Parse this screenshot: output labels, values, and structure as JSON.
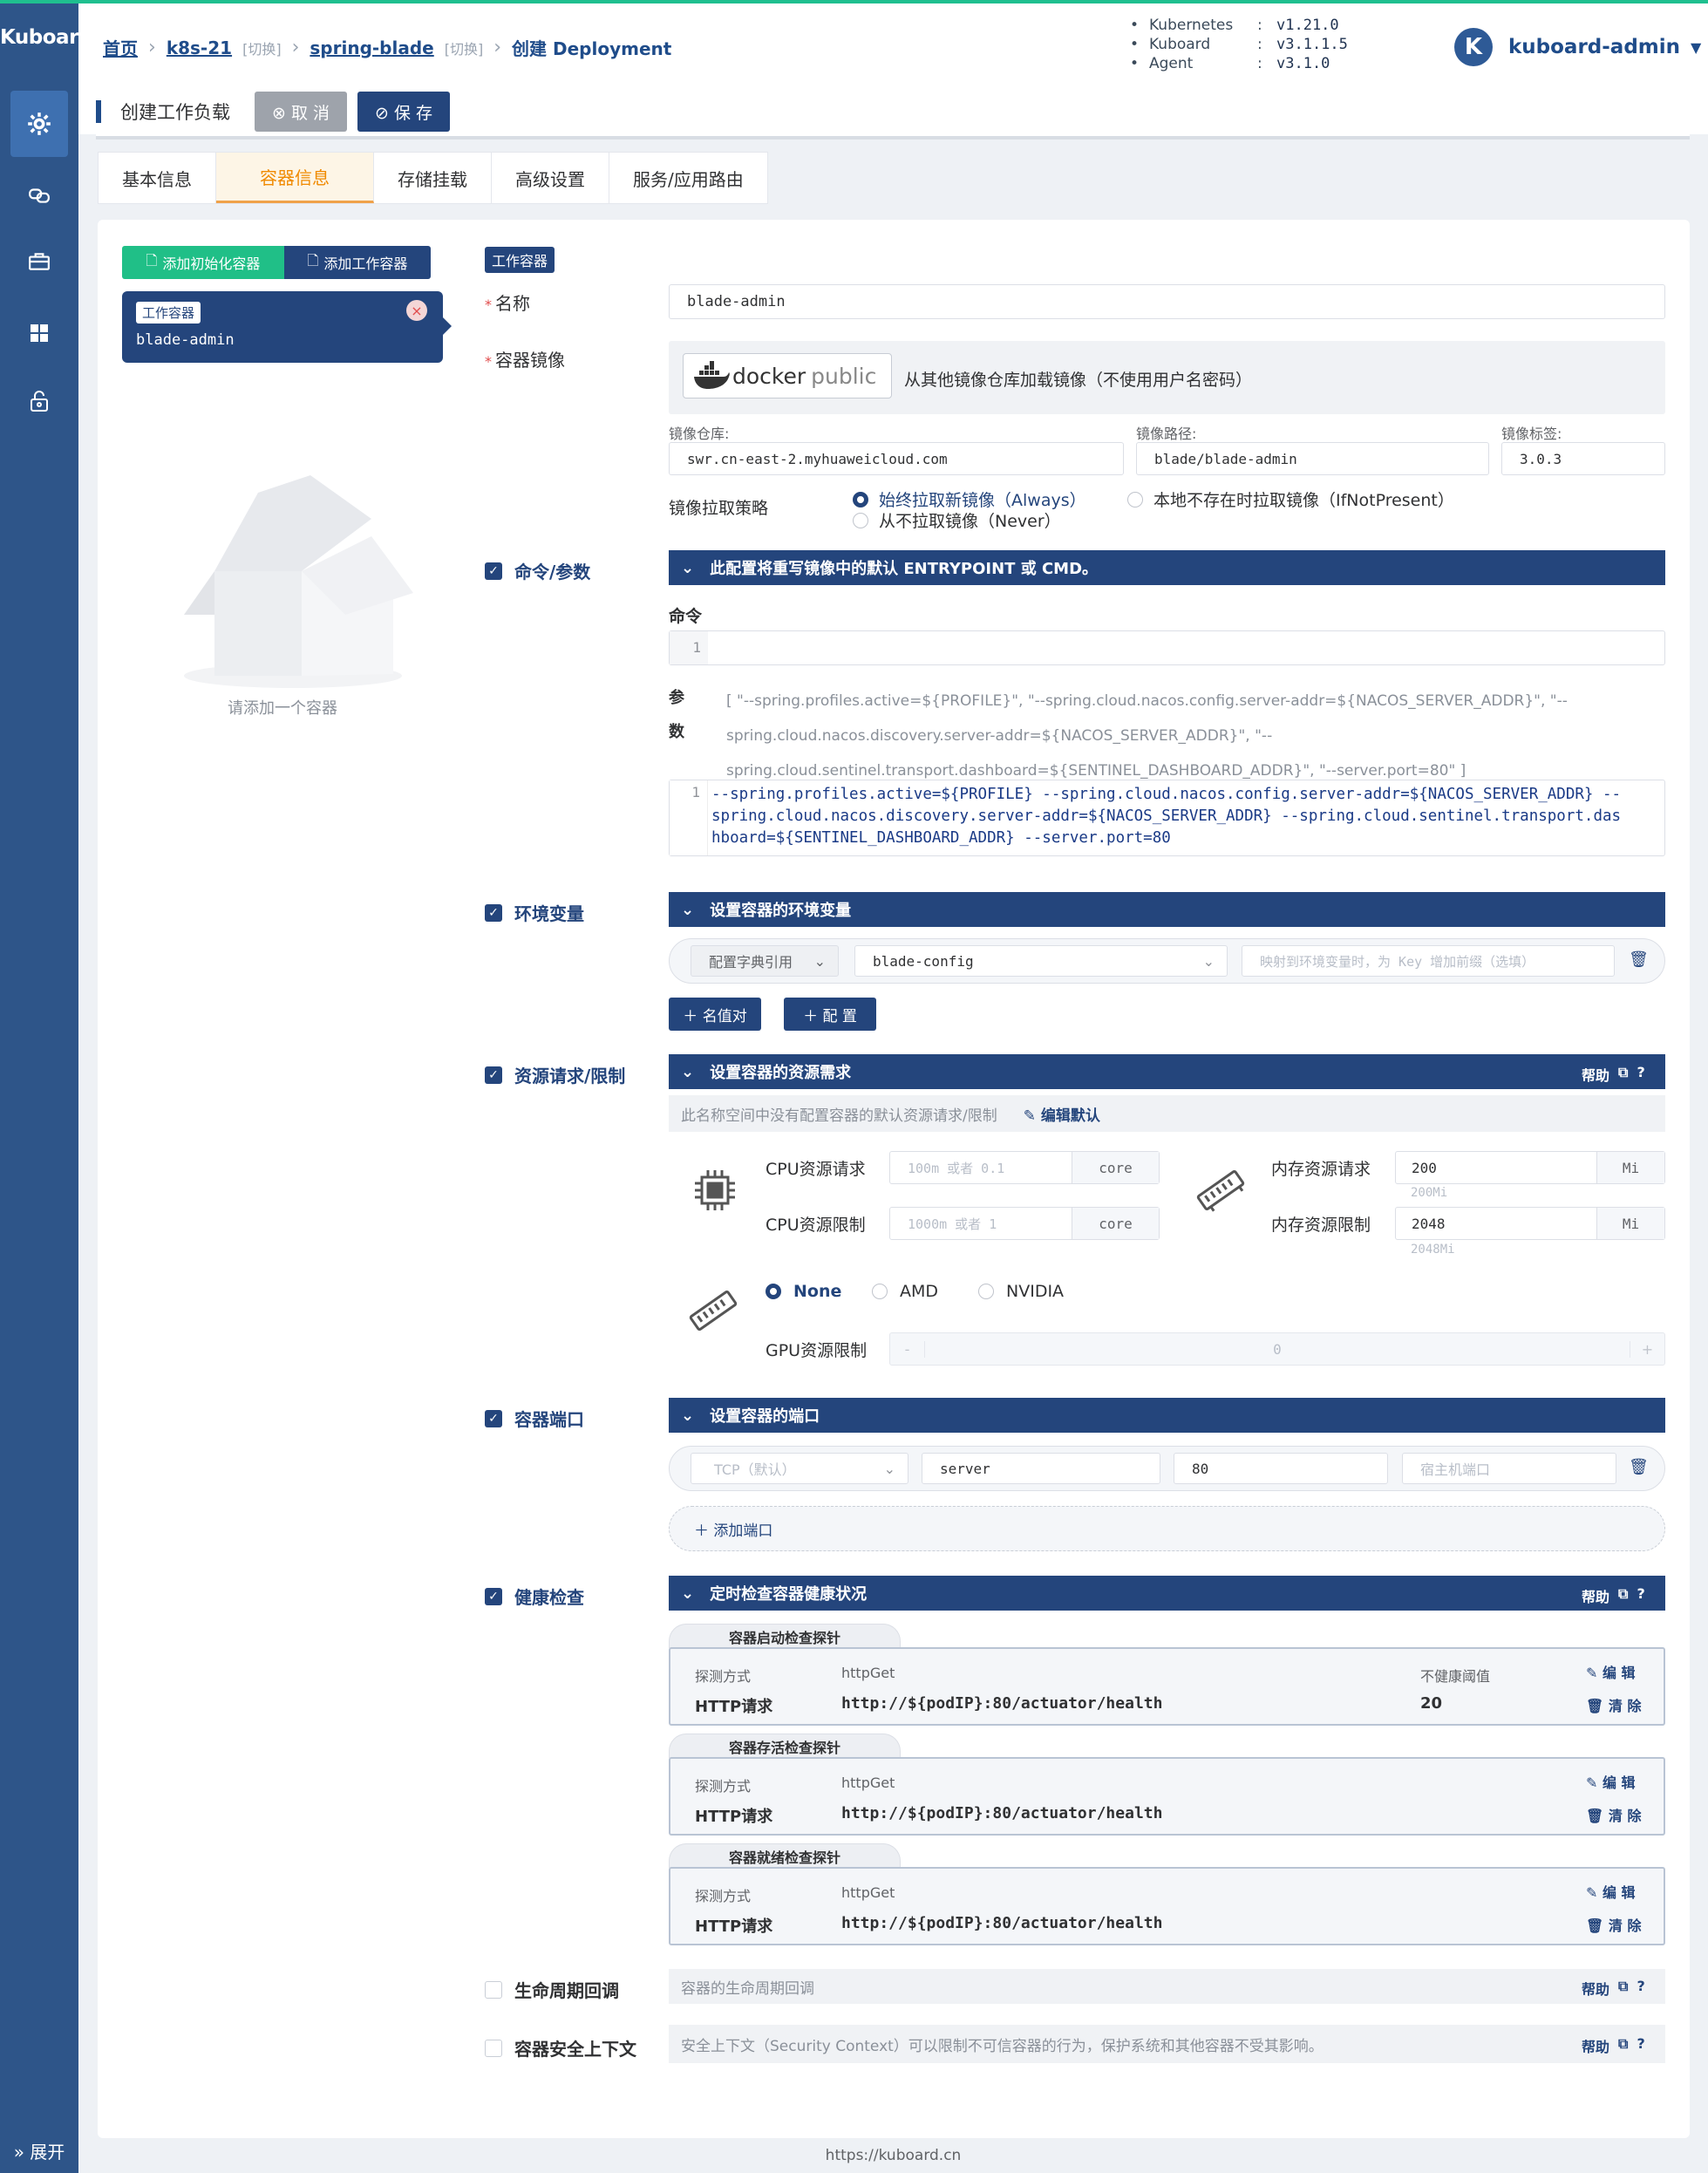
{
  "app": {
    "brand": "Kuboard",
    "expand_label": "展开",
    "footer_url": "https://kuboard.cn"
  },
  "sidebar_icons": [
    "gear-icon",
    "link-icon",
    "briefcase-icon",
    "grid-icon",
    "unlock-icon"
  ],
  "breadcrumb": {
    "home": "首页",
    "cluster": "k8s-21",
    "cluster_switch": "[切换]",
    "namespace": "spring-blade",
    "namespace_switch": "[切换]",
    "current": "创建 Deployment"
  },
  "versions": [
    {
      "name": "Kubernetes",
      "colon": ":",
      "value": "v1.21.0"
    },
    {
      "name": "Kuboard",
      "colon": ":",
      "value": "v3.1.1.5"
    },
    {
      "name": "Agent",
      "colon": ":",
      "value": "v3.1.0"
    }
  ],
  "user": {
    "avatar_letter": "K",
    "name": "kuboard-admin",
    "caret": "▼"
  },
  "titlebar": {
    "title": "创建工作负载",
    "cancel": "⊗ 取 消",
    "save": "⊘ 保 存"
  },
  "tabs": [
    {
      "label": "基本信息",
      "active": false
    },
    {
      "label": "容器信息",
      "active": true
    },
    {
      "label": "存储挂载",
      "active": false
    },
    {
      "label": "高级设置",
      "active": false
    },
    {
      "label": "服务/应用路由",
      "active": false
    }
  ],
  "containers": {
    "add_init": "添加初始化容器",
    "add_work": "添加工作容器",
    "card_tag": "工作容器",
    "card_name": "blade-admin",
    "empty_hint": "请添加一个容器"
  },
  "form": {
    "type_tag": "工作容器",
    "name_label": "名称",
    "name_value": "blade-admin",
    "image_label": "容器镜像",
    "docker_logo": "docker",
    "docker_logo_suffix": "public",
    "image_source_text": "从其他镜像仓库加载镜像（不使用用户名密码）",
    "registry_label": "镜像仓库:",
    "registry_value": "swr.cn-east-2.myhuaweicloud.com",
    "path_label": "镜像路径:",
    "path_value": "blade/blade-admin",
    "tag_label": "镜像标签:",
    "tag_value": "3.0.3",
    "pull_label": "镜像拉取策略",
    "pull_always": "始终拉取新镜像（Always）",
    "pull_ifnotpresent": "本地不存在时拉取镜像（IfNotPresent）",
    "pull_never": "从不拉取镜像（Never）"
  },
  "command": {
    "label": "命令/参数",
    "bar": "此配置将重写镜像中的默认 ENTRYPOINT 或 CMD。",
    "cmd_label": "命令",
    "line_no": "1",
    "args_label_1": "参",
    "args_label_2": "数",
    "args_json_1": "[ \"--spring.profiles.active=${PROFILE}\", \"--spring.cloud.nacos.config.server-addr=${NACOS_SERVER_ADDR}\", \"--",
    "args_json_2": "spring.cloud.nacos.discovery.server-addr=${NACOS_SERVER_ADDR}\", \"--",
    "args_json_3": "spring.cloud.sentinel.transport.dashboard=${SENTINEL_DASHBOARD_ADDR}\", \"--server.port=80\" ]",
    "args_line_no": "1",
    "args_code_1": "--spring.profiles.active=${PROFILE} --spring.cloud.nacos.config.server-addr=${NACOS_SERVER_ADDR} --",
    "args_code_2": "spring.cloud.nacos.discovery.server-addr=${NACOS_SERVER_ADDR} --spring.cloud.sentinel.transport.das",
    "args_code_3": "hboard=${SENTINEL_DASHBOARD_ADDR} --server.port=80"
  },
  "env": {
    "label": "环境变量",
    "bar": "设置容器的环境变量",
    "type_value": "配置字典引用",
    "config_value": "blade-config",
    "prefix_placeholder": "映射到环境变量时，为 Key 增加前缀（选填）",
    "add_pair": "＋ 名值对",
    "add_config": "＋ 配 置"
  },
  "resources": {
    "label": "资源请求/限制",
    "bar": "设置容器的资源需求",
    "help": "帮助",
    "no_default": "此名称空间中没有配置容器的默认资源请求/限制",
    "edit_default": "编辑默认",
    "cpu_request_label": "CPU资源请求",
    "cpu_request_placeholder": "100m 或者 0.1",
    "cpu_limit_label": "CPU资源限制",
    "cpu_limit_placeholder": "1000m 或者 1",
    "cpu_unit": "core",
    "mem_request_label": "内存资源请求",
    "mem_request_value": "200",
    "mem_request_hint": "200Mi",
    "mem_limit_label": "内存资源限制",
    "mem_limit_value": "2048",
    "mem_limit_hint": "2048Mi",
    "mem_unit": "Mi",
    "gpu_none": "None",
    "gpu_amd": "AMD",
    "gpu_nvidia": "NVIDIA",
    "gpu_limit_label": "GPU资源限制",
    "gpu_limit_value": "0",
    "gpu_minus": "-",
    "gpu_plus": "+"
  },
  "ports": {
    "label": "容器端口",
    "bar": "设置容器的端口",
    "protocol_placeholder": "TCP（默认）",
    "name_value": "server",
    "port_value": "80",
    "host_port_placeholder": "宿主机端口",
    "add_port": "＋ 添加端口"
  },
  "health": {
    "label": "健康检查",
    "bar": "定时检查容器健康状况",
    "help": "帮助",
    "probes": [
      {
        "title": "容器启动检查探针",
        "method_label": "探测方式",
        "method_value": "httpGet",
        "req_label": "HTTP请求",
        "req_value": "http://${podIP}:80/actuator/health",
        "threshold_label": "不健康阈值",
        "threshold_value": "20",
        "edit": "编 辑",
        "clear": "清 除"
      },
      {
        "title": "容器存活检查探针",
        "method_label": "探测方式",
        "method_value": "httpGet",
        "req_label": "HTTP请求",
        "req_value": "http://${podIP}:80/actuator/health",
        "edit": "编 辑",
        "clear": "清 除"
      },
      {
        "title": "容器就绪检查探针",
        "method_label": "探测方式",
        "method_value": "httpGet",
        "req_label": "HTTP请求",
        "req_value": "http://${podIP}:80/actuator/health",
        "edit": "编 辑",
        "clear": "清 除"
      }
    ]
  },
  "lifecycle": {
    "label": "生命周期回调",
    "text": "容器的生命周期回调",
    "help": "帮助"
  },
  "security": {
    "label": "容器安全上下文",
    "text": "安全上下文（Security Context）可以限制不可信容器的行为，保护系统和其他容器不受其影响。",
    "help": "帮助"
  },
  "colors": {
    "primary": "#24457c",
    "sidebar": "#2e5589",
    "green": "#20bf87",
    "tab_active": "#f08a00",
    "required": "#e14c4c"
  }
}
